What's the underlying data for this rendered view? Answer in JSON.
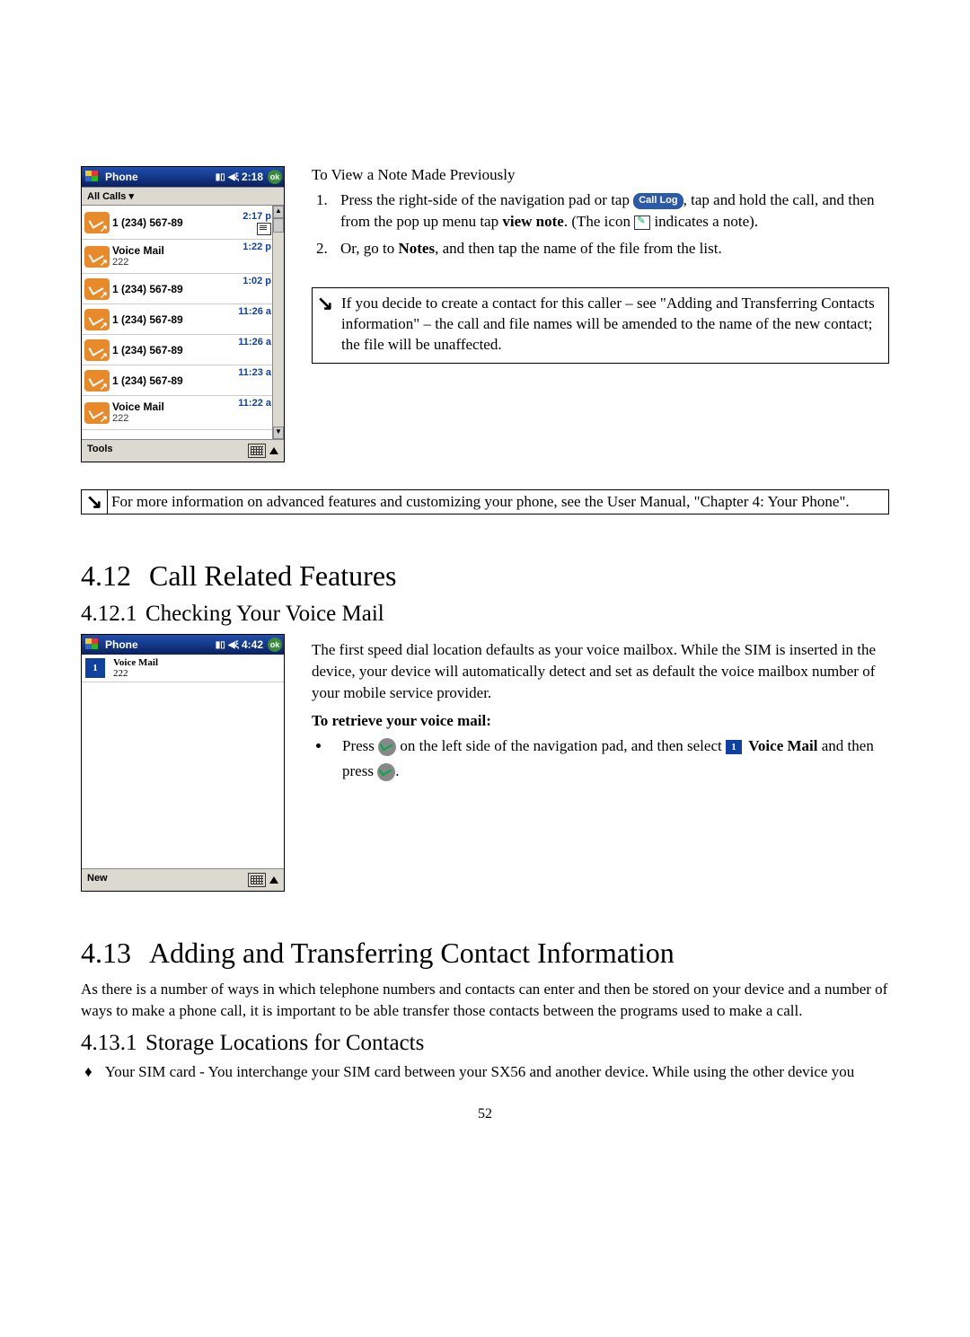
{
  "screenshot1": {
    "titlebar": {
      "app": "Phone",
      "time": "2:18",
      "ok": "ok"
    },
    "filter": "All Calls ▾",
    "rows": [
      {
        "name": "1 (234) 567-89",
        "sub": "",
        "time": "2:17 p",
        "note": true
      },
      {
        "name": "Voice Mail",
        "sub": "222",
        "time": "1:22 p"
      },
      {
        "name": "1 (234) 567-89",
        "sub": "",
        "time": "1:02 p"
      },
      {
        "name": "1 (234) 567-89",
        "sub": "",
        "time": "11:26 a"
      },
      {
        "name": "1 (234) 567-89",
        "sub": "",
        "time": "11:26 a"
      },
      {
        "name": "1 (234) 567-89",
        "sub": "",
        "time": "11:23 a"
      },
      {
        "name": "Voice Mail",
        "sub": "222",
        "time": "11:22 a"
      }
    ],
    "menu": "Tools"
  },
  "viewnote": {
    "heading": "To View a Note Made Previously",
    "step1a": "Press the right-side of the navigation pad or tap ",
    "callbtn": "Call Log",
    "step1b": ", tap and hold the call, and then from the pop up menu tap ",
    "viewnote": "view note",
    "step1c": ". (The icon ",
    "step1d": " indicates a note).",
    "step2a": "Or, go to ",
    "notes": "Notes",
    "step2b": ", and then tap the name of the file from the list."
  },
  "note1": "If you decide to create a contact for this caller – see \"Adding and Transferring Contacts information\" – the call and file names will be amended to the name of the new contact; the file will be unaffected.",
  "note2": "For more information on advanced features and customizing your phone, see the User Manual, \"Chapter 4: Your Phone\".",
  "h412": {
    "num": "4.12",
    "title": "Call Related Features"
  },
  "h4121": {
    "num": "4.12.1",
    "title": "Checking Your Voice Mail"
  },
  "screenshot2": {
    "titlebar": {
      "app": "Phone",
      "time": "4:42",
      "ok": "ok"
    },
    "row": {
      "name": "Voice Mail",
      "sub": "222"
    },
    "menu": "New"
  },
  "vmtext": "The first speed dial location defaults as your voice mailbox.  While the SIM is inserted in the device, your device will automatically detect and set as default the voice mailbox number of your mobile service provider.",
  "vmheading": "To retrieve your voice mail:",
  "vmstep_a": "Press ",
  "vmstep_b": " on the left side of the navigation pad, and then select ",
  "vmlabel": "Voice Mail",
  "vmstep_c": " and then press ",
  "vmstep_d": ".",
  "speed1": "1",
  "h413": {
    "num": "4.13",
    "title": "Adding and Transferring Contact Information"
  },
  "p413": "As there is a number of ways in which telephone numbers and contacts can enter and then be stored on your device and a number of ways to make a phone call, it is important to be able transfer those contacts between the programs used to make a call.",
  "h4131": {
    "num": "4.13.1",
    "title": "Storage Locations for Contacts"
  },
  "bullet4131": "Your SIM card - You interchange your SIM card between your SX56 and another device.  While using the other device you",
  "pagenum": "52"
}
